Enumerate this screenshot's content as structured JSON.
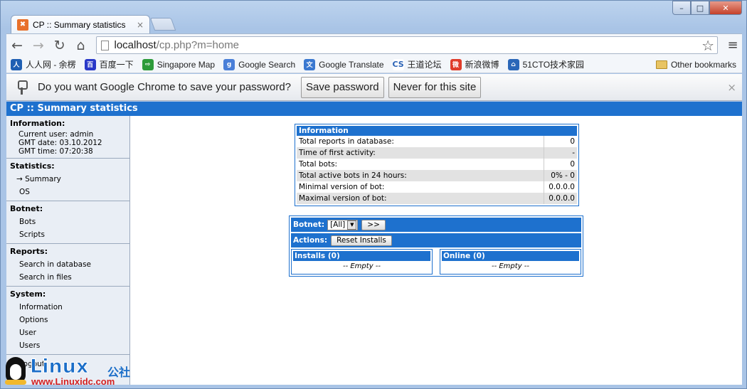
{
  "window": {
    "controls": {
      "minimize": "–",
      "maximize": "□",
      "close": "✕"
    }
  },
  "tab": {
    "title": "CP :: Summary statistics",
    "close": "×",
    "favicon_text": "✖"
  },
  "toolbar": {
    "back_icon": "←",
    "forward_icon": "→",
    "reload_icon": "↻",
    "home_icon": "⌂",
    "url_host": "localhost",
    "url_path": "/cp.php?m=home",
    "star_icon": "☆",
    "menu_icon": "≡"
  },
  "bookmarks": {
    "items": [
      {
        "label": "人人网 - 余楞",
        "color": "#1f5fb3",
        "glyph": "人"
      },
      {
        "label": "百度一下",
        "color": "#2a39c8",
        "glyph": "百"
      },
      {
        "label": "Singapore Map",
        "color": "#2d9b3a",
        "glyph": "⇨"
      },
      {
        "label": "Google Search",
        "color": "#4a7fd8",
        "glyph": "g"
      },
      {
        "label": "Google Translate",
        "color": "#3a78d0",
        "glyph": "文"
      },
      {
        "label": "王道论坛",
        "color": "#ffffff",
        "glyph": "CS"
      },
      {
        "label": "新浪微博",
        "color": "#e03c2a",
        "glyph": "微"
      },
      {
        "label": "51CTO技术家园",
        "color": "#2b67b8",
        "glyph": "⌂"
      }
    ],
    "other": "Other bookmarks"
  },
  "infobar": {
    "message": "Do you want Google Chrome to save your password?",
    "save_label": "Save password",
    "never_label": "Never for this site",
    "close": "×"
  },
  "page": {
    "header": "CP :: Summary statistics",
    "sidebar": {
      "information": {
        "title": "Information:",
        "lines": [
          "Current user: admin",
          "GMT date: 03.10.2012",
          "GMT time: 07:20:38"
        ]
      },
      "statistics": {
        "title": "Statistics:",
        "items": [
          "Summary",
          "OS"
        ]
      },
      "botnet": {
        "title": "Botnet:",
        "items": [
          "Bots",
          "Scripts"
        ]
      },
      "reports": {
        "title": "Reports:",
        "items": [
          "Search in database",
          "Search in files"
        ]
      },
      "system": {
        "title": "System:",
        "items": [
          "Information",
          "Options",
          "User",
          "Users"
        ]
      },
      "logout": "Logout"
    },
    "info_table": {
      "title": "Information",
      "rows": [
        {
          "label": "Total reports in database:",
          "value": "0"
        },
        {
          "label": "Time of first activity:",
          "value": "-"
        },
        {
          "label": "Total bots:",
          "value": "0"
        },
        {
          "label": "Total active bots in 24 hours:",
          "value": "0% - 0"
        },
        {
          "label": "Minimal version of bot:",
          "value": "0.0.0.0"
        },
        {
          "label": "Maximal version of bot:",
          "value": "0.0.0.0"
        }
      ]
    },
    "botnet_box": {
      "botnet_label": "Botnet:",
      "botnet_selected": "[All]",
      "go_label": ">>",
      "actions_label": "Actions:",
      "reset_label": "Reset Installs",
      "installs_title": "Installs (0)",
      "installs_empty": "-- Empty --",
      "online_title": "Online (0)",
      "online_empty": "-- Empty --"
    }
  },
  "watermark": {
    "title": "Linux",
    "cn": "公社",
    "url": "www.Linuxidc.com"
  }
}
